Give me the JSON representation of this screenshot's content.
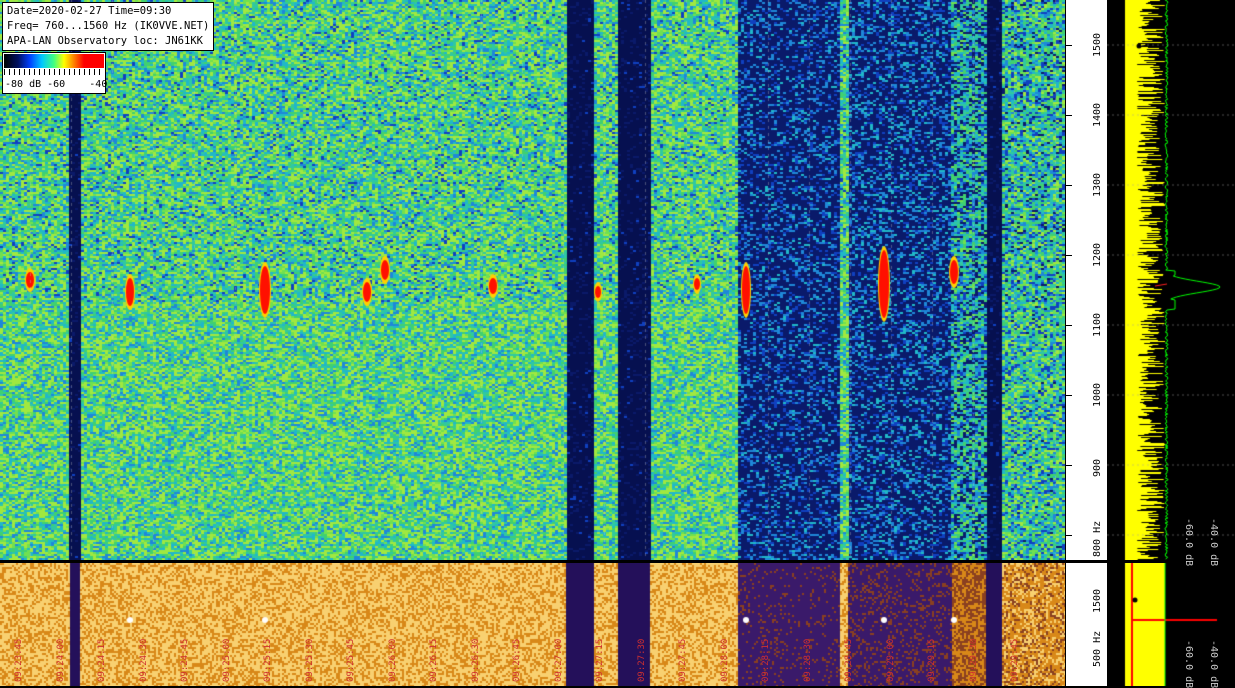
{
  "header": {
    "line1": "Date=2020-02-27 Time=09:30",
    "line2": "Freq= 760...1560 Hz (IK0VVE.NET)",
    "line3": "APA-LAN Observatory loc: JN61KK"
  },
  "color_scale": {
    "labels": "-80 dB -60    -40"
  },
  "freq_axis_top": {
    "ticks": [
      "1500",
      "1400",
      "1300",
      "1200",
      "1100",
      "1000",
      "900",
      "800 Hz"
    ]
  },
  "freq_axis_bottom": {
    "ticks": [
      "1500",
      "500 Hz"
    ]
  },
  "spectrum_labels": {
    "top_left": "-60.0 dB",
    "top_right": "-40.0 dB",
    "bottom_left": "-60.0 dB",
    "bottom_right": "-40.0 dB"
  },
  "time_labels": [
    "09:23:45",
    "09:24:00",
    "09:24:15",
    "09:24:30",
    "09:24:45",
    "09:25:00",
    "09:25:15",
    "09:25:30",
    "09:25:45",
    "09:26:00",
    "09:26:15",
    "09:26:30",
    "09:26:45",
    "09:27:00",
    "09:27:15",
    "09:27:30",
    "09:27:45",
    "09:28:00",
    "09:28:15",
    "09:28:30",
    "09:28:45",
    "09:29:00",
    "09:29:15",
    "09:29:30",
    "09:29:45"
  ],
  "colors": {
    "waterfall_base": "#2a9a8a",
    "signal": "#ff0000",
    "lower_panel": "#e8a020",
    "spectrum_yellow": "#ffff00",
    "spectrum_green": "#00ff00"
  }
}
